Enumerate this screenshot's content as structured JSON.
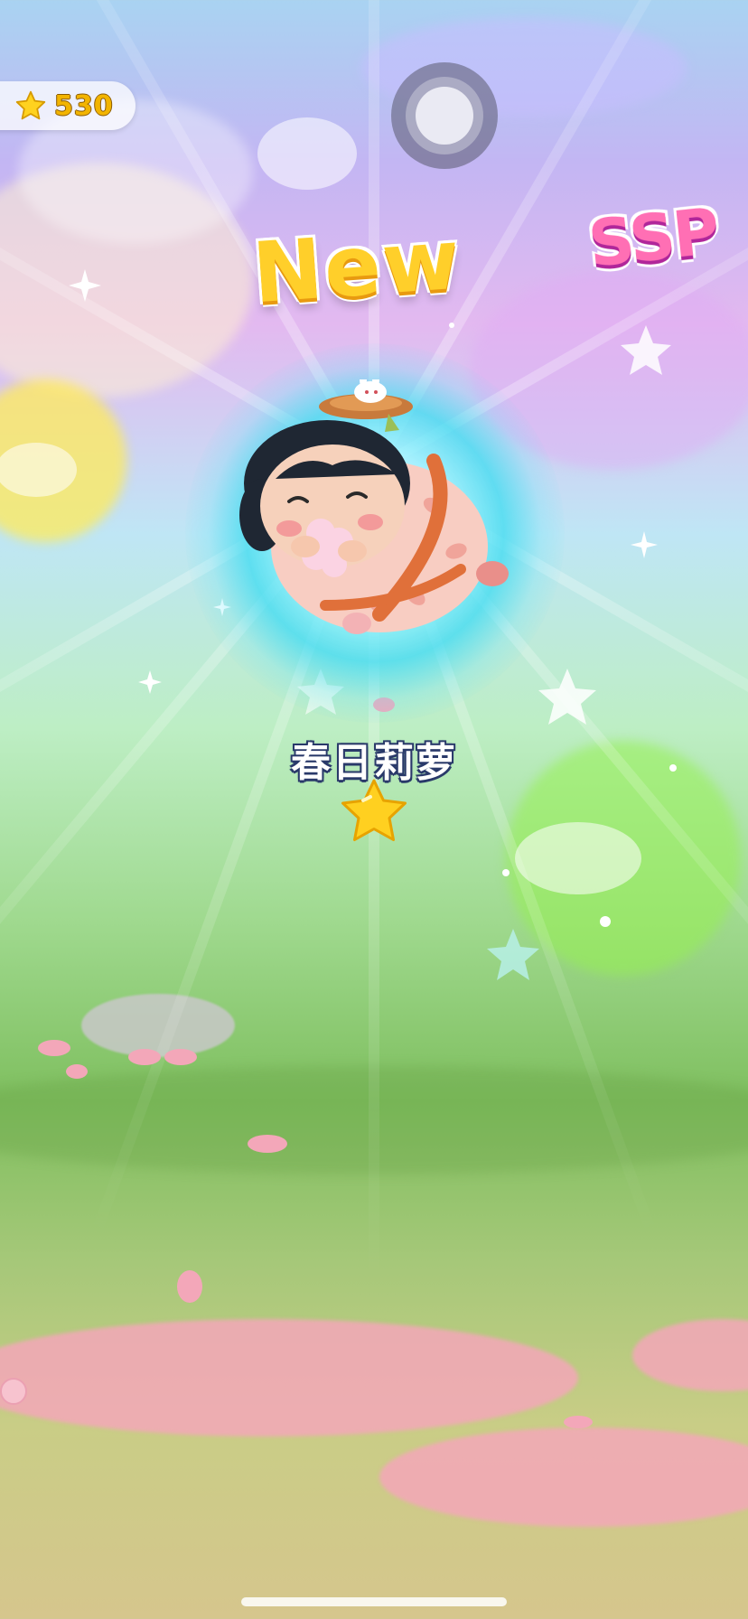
{
  "hud": {
    "star_count": "530",
    "star_icon": "star-icon"
  },
  "banner": {
    "new_label": "New",
    "rarity_label": "SSP"
  },
  "character": {
    "name": "春日莉萝",
    "star_rating": 1
  },
  "colors": {
    "gold": "#ffcf2a",
    "pink": "#ff6fb4",
    "glow": "#46dcf0",
    "grass": "#7fbf5f",
    "petal": "#f3a7b9"
  }
}
